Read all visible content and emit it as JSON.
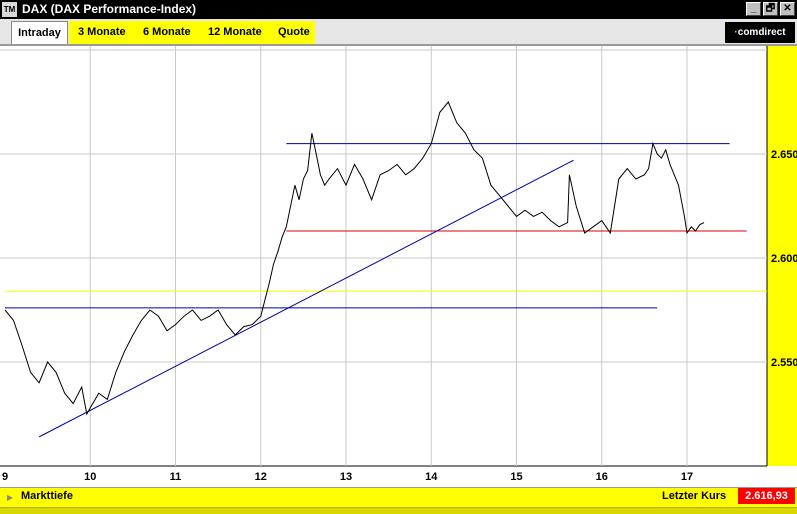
{
  "window": {
    "icon_label": "TM",
    "title": "DAX (DAX Performance-Index)",
    "buttons": [
      "_",
      "🗗",
      "✕"
    ]
  },
  "tabs": {
    "active": "Intraday",
    "items": [
      "3 Monate",
      "6 Monate",
      "12 Monate",
      "Quote"
    ]
  },
  "logo": {
    "prefix": "·",
    "text": "comdirect"
  },
  "bottom_bar": {
    "left_label": "Markttiefe",
    "right_label": "Letzter Kurs",
    "price": "2.616,93"
  },
  "colors": {
    "price_line": "#000000",
    "trend_lines": "#0000a0",
    "support_line": "#e00000",
    "reference_line": "#ffff00",
    "axis_panel": "#ffff00",
    "price_badge": "#ff0000"
  },
  "chart_data": {
    "type": "line",
    "title": "",
    "xlabel": "",
    "ylabel": "",
    "x_ticks": [
      9,
      10,
      11,
      12,
      13,
      14,
      15,
      16,
      17
    ],
    "x_tick_labels": [
      "9",
      "10",
      "11",
      "12",
      "13",
      "14",
      "15",
      "16",
      "17"
    ],
    "y_ticks": [
      2550,
      2600,
      2650
    ],
    "y_tick_labels": [
      "2.550",
      "2.600",
      "2.650"
    ],
    "xlim": [
      9,
      17.95
    ],
    "ylim": [
      2505,
      2700
    ],
    "grid": true,
    "series": [
      {
        "x": [
          9.0,
          9.1,
          9.2,
          9.3,
          9.4,
          9.5,
          9.6,
          9.7,
          9.8,
          9.9,
          9.96,
          10.0,
          10.1,
          10.2,
          10.3,
          10.4,
          10.5,
          10.6,
          10.7,
          10.8,
          10.9,
          11.0,
          11.1,
          11.2,
          11.3,
          11.4,
          11.5,
          11.6,
          11.7,
          11.8,
          11.9,
          12.0,
          12.05,
          12.1,
          12.15,
          12.2,
          12.25,
          12.3,
          12.4,
          12.45,
          12.5,
          12.55,
          12.6,
          12.65,
          12.7,
          12.75,
          12.8,
          12.9,
          13.0,
          13.1,
          13.2,
          13.3,
          13.4,
          13.5,
          13.6,
          13.7,
          13.8,
          13.9,
          14.0,
          14.1,
          14.2,
          14.3,
          14.4,
          14.5,
          14.6,
          14.7,
          14.8,
          14.9,
          15.0,
          15.1,
          15.2,
          15.3,
          15.4,
          15.5,
          15.6,
          15.62,
          15.7,
          15.8,
          15.9,
          16.0,
          16.1,
          16.2,
          16.3,
          16.4,
          16.5,
          16.55,
          16.6,
          16.65,
          16.7,
          16.75,
          16.8,
          16.9,
          16.97,
          17.0,
          17.05,
          17.1,
          17.15,
          17.2
        ],
        "y": [
          2575,
          2570,
          2558,
          2545,
          2540,
          2550,
          2545,
          2535,
          2530,
          2538,
          2525,
          2528,
          2535,
          2532,
          2545,
          2555,
          2563,
          2570,
          2575,
          2572,
          2565,
          2568,
          2572,
          2575,
          2570,
          2572,
          2575,
          2568,
          2563,
          2567,
          2568,
          2572,
          2580,
          2588,
          2597,
          2603,
          2610,
          2615,
          2635,
          2628,
          2638,
          2642,
          2660,
          2650,
          2640,
          2635,
          2638,
          2643,
          2635,
          2645,
          2638,
          2628,
          2640,
          2642,
          2645,
          2640,
          2643,
          2648,
          2655,
          2670,
          2675,
          2665,
          2660,
          2652,
          2648,
          2635,
          2630,
          2625,
          2620,
          2623,
          2620,
          2622,
          2618,
          2615,
          2617,
          2640,
          2625,
          2612,
          2615,
          2618,
          2612,
          2638,
          2643,
          2638,
          2640,
          2643,
          2655,
          2650,
          2648,
          2652,
          2645,
          2635,
          2620,
          2612,
          2615,
          2613,
          2616,
          2617
        ]
      }
    ],
    "annotation_lines": [
      {
        "name": "resistance",
        "x": [
          12.3,
          17.5
        ],
        "y": [
          2655,
          2655
        ]
      },
      {
        "name": "support",
        "x": [
          12.3,
          17.7
        ],
        "y": [
          2613,
          2613
        ]
      },
      {
        "name": "resistance-old",
        "x": [
          9.0,
          16.65
        ],
        "y": [
          2576,
          2576
        ]
      },
      {
        "name": "reference",
        "x": [
          9.0,
          17.95
        ],
        "y": [
          2584,
          2584
        ]
      },
      {
        "name": "uptrend",
        "x": [
          9.4,
          15.67
        ],
        "y": [
          2514,
          2647
        ]
      }
    ]
  }
}
